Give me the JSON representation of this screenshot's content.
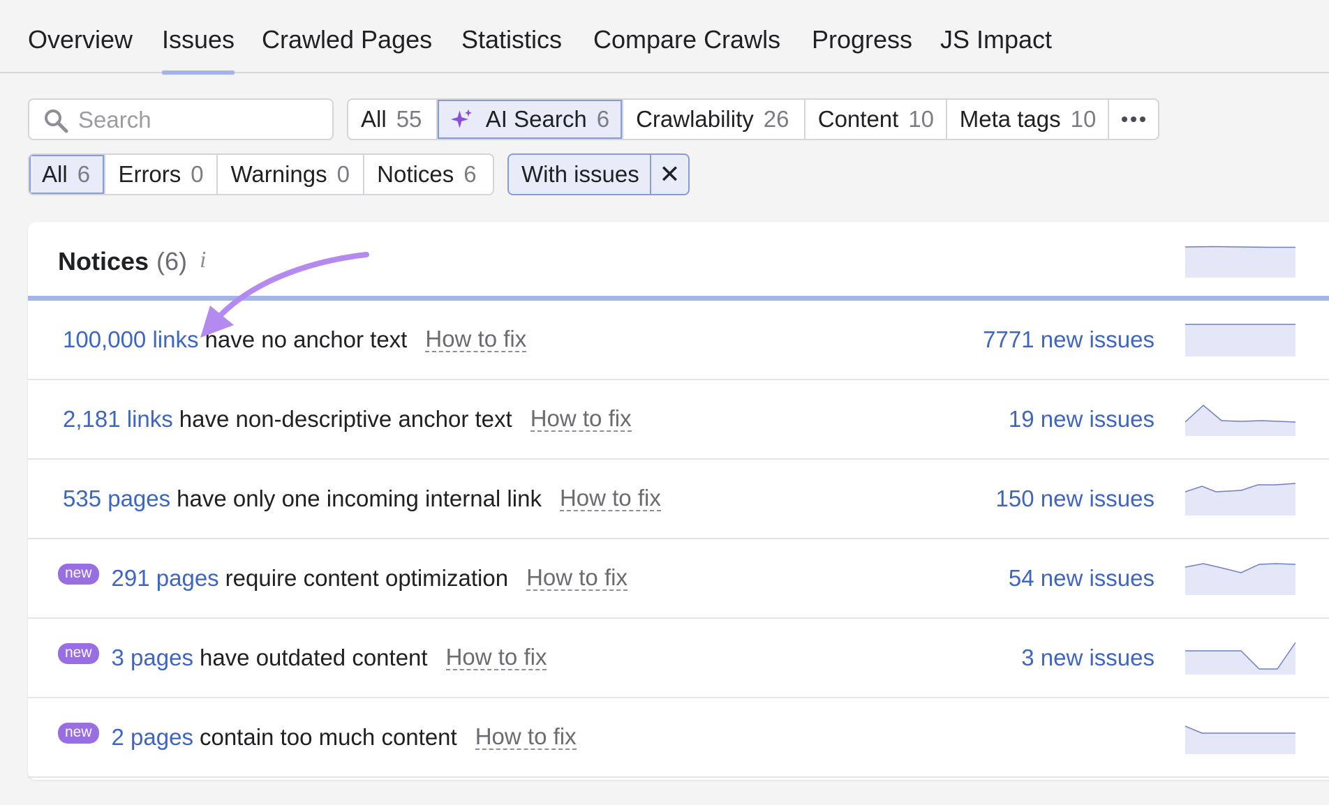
{
  "tabs": [
    {
      "label": "Overview"
    },
    {
      "label": "Issues"
    },
    {
      "label": "Crawled Pages"
    },
    {
      "label": "Statistics"
    },
    {
      "label": "Compare Crawls"
    },
    {
      "label": "Progress"
    },
    {
      "label": "JS Impact"
    }
  ],
  "active_tab": "Issues",
  "search": {
    "placeholder": "Search"
  },
  "category_filters": [
    {
      "label": "All",
      "count": "55"
    },
    {
      "label": "AI Search",
      "count": "6",
      "selected": true,
      "icon": "sparkle-icon"
    },
    {
      "label": "Crawlability",
      "count": "26"
    },
    {
      "label": "Content",
      "count": "10"
    },
    {
      "label": "Meta tags",
      "count": "10"
    }
  ],
  "more_icon": "more-dots-icon",
  "type_filters": [
    {
      "label": "All",
      "count": "6",
      "selected": true
    },
    {
      "label": "Errors",
      "count": "0"
    },
    {
      "label": "Warnings",
      "count": "0"
    },
    {
      "label": "Notices",
      "count": "6"
    }
  ],
  "with_issues": {
    "label": "With issues",
    "close": "✕"
  },
  "section": {
    "title": "Notices",
    "count": "(6)",
    "info": "i"
  },
  "issues": [
    {
      "badge": "",
      "link": "100,000 links",
      "text": "have no anchor text",
      "howto": "How to fix",
      "new_issues": "7771 new issues"
    },
    {
      "badge": "",
      "link": "2,181 links",
      "text": "have non-descriptive anchor text",
      "howto": "How to fix",
      "new_issues": "19 new issues"
    },
    {
      "badge": "",
      "link": "535 pages",
      "text": "have only one incoming internal link",
      "howto": "How to fix",
      "new_issues": "150 new issues"
    },
    {
      "badge": "new",
      "link": "291 pages",
      "text": "require content optimization",
      "howto": "How to fix",
      "new_issues": "54 new issues"
    },
    {
      "badge": "new",
      "link": "3 pages",
      "text": "have outdated content",
      "howto": "How to fix",
      "new_issues": "3 new issues"
    },
    {
      "badge": "new",
      "link": "2 pages",
      "text": "contain too much content",
      "howto": "How to fix",
      "new_issues": ""
    }
  ],
  "colors": {
    "link": "#3d65c4",
    "accent_underline": "#a4b3e8",
    "badge": "#9a6ee3",
    "spark_fill": "#e4e7f8",
    "spark_line": "#6f7fc4",
    "annotation_arrow": "#b48af0"
  }
}
